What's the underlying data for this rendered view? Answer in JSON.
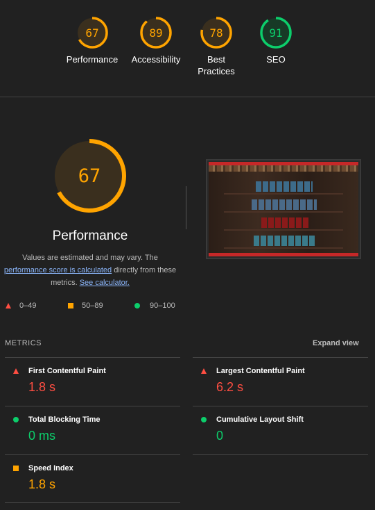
{
  "colors": {
    "fail": "#ff4e42",
    "average": "#ffa400",
    "pass": "#0cce6b"
  },
  "categories": [
    {
      "label": "Performance",
      "score": 67,
      "rating": "average"
    },
    {
      "label": "Accessibility",
      "score": 89,
      "rating": "average"
    },
    {
      "label": "Best Practices",
      "score": 78,
      "rating": "average"
    },
    {
      "label": "SEO",
      "score": 91,
      "rating": "pass"
    }
  ],
  "main": {
    "score": 67,
    "title": "Performance",
    "desc_1": "Values are estimated and may vary. The",
    "desc_link": "performance score is calculated",
    "desc_2": "directly from these metrics.",
    "calc_link": "See calculator.",
    "screenshot_alt": "page screenshot"
  },
  "legend": [
    {
      "icon": "triangle-icon",
      "range": "0–49"
    },
    {
      "icon": "square-icon",
      "range": "50–89"
    },
    {
      "icon": "circle-icon",
      "range": "90–100"
    }
  ],
  "metrics": {
    "title": "METRICS",
    "expand": "Expand view",
    "items": [
      {
        "label": "First Contentful Paint",
        "value": "1.8 s",
        "rating": "fail"
      },
      {
        "label": "Largest Contentful Paint",
        "value": "6.2 s",
        "rating": "fail"
      },
      {
        "label": "Total Blocking Time",
        "value": "0 ms",
        "rating": "pass"
      },
      {
        "label": "Cumulative Layout Shift",
        "value": "0",
        "rating": "pass"
      },
      {
        "label": "Speed Index",
        "value": "1.8 s",
        "rating": "average"
      }
    ]
  }
}
